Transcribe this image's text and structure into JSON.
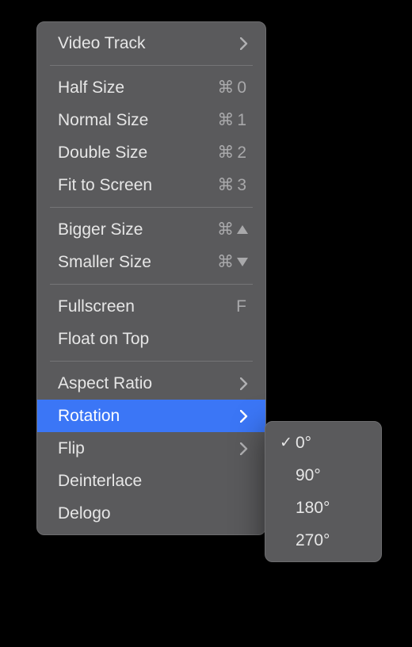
{
  "menu": {
    "video_track": {
      "label": "Video Track",
      "has_submenu": true
    },
    "half_size": {
      "label": "Half Size",
      "shortcut_sym": "⌘",
      "shortcut_key": "0"
    },
    "normal_size": {
      "label": "Normal Size",
      "shortcut_sym": "⌘",
      "shortcut_key": "1"
    },
    "double_size": {
      "label": "Double Size",
      "shortcut_sym": "⌘",
      "shortcut_key": "2"
    },
    "fit_to_screen": {
      "label": "Fit to Screen",
      "shortcut_sym": "⌘",
      "shortcut_key": "3"
    },
    "bigger_size": {
      "label": "Bigger Size",
      "shortcut_sym": "⌘",
      "shortcut_glyph": "up"
    },
    "smaller_size": {
      "label": "Smaller Size",
      "shortcut_sym": "⌘",
      "shortcut_glyph": "down"
    },
    "fullscreen": {
      "label": "Fullscreen",
      "shortcut_key": "F"
    },
    "float_on_top": {
      "label": "Float on Top"
    },
    "aspect_ratio": {
      "label": "Aspect Ratio",
      "has_submenu": true
    },
    "rotation": {
      "label": "Rotation",
      "has_submenu": true,
      "highlighted": true
    },
    "flip": {
      "label": "Flip",
      "has_submenu": true
    },
    "deinterlace": {
      "label": "Deinterlace"
    },
    "delogo": {
      "label": "Delogo"
    }
  },
  "rotation_submenu": {
    "items": [
      {
        "label": "0°",
        "checked": true
      },
      {
        "label": "90°",
        "checked": false
      },
      {
        "label": "180°",
        "checked": false
      },
      {
        "label": "270°",
        "checked": false
      }
    ]
  }
}
